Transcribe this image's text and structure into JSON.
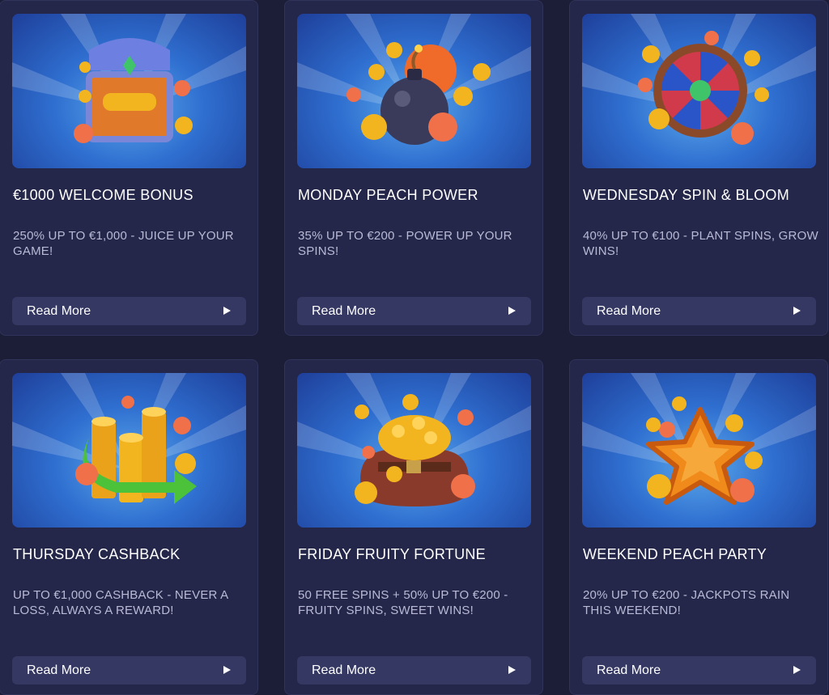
{
  "promotions": [
    {
      "title": "€1000 WELCOME BONUS",
      "description": "250% UP TO €1,000 - JUICE UP YOUR GAME!",
      "button_label": "Read More",
      "icon": "treasure-chest-icon"
    },
    {
      "title": "MONDAY PEACH POWER",
      "description": "35% UP TO €200 - POWER UP YOUR SPINS!",
      "button_label": "Read More",
      "icon": "bomb-icon"
    },
    {
      "title": "WEDNESDAY SPIN & BLOOM",
      "description": "40% UP TO €100 - PLANT SPINS, GROW WINS!",
      "button_label": "Read More",
      "icon": "prize-wheel-icon"
    },
    {
      "title": "THURSDAY CASHBACK",
      "description": "UP TO €1,000 CASHBACK - NEVER A LOSS, ALWAYS A REWARD!",
      "button_label": "Read More",
      "icon": "coin-stacks-arrow-icon"
    },
    {
      "title": "FRIDAY FRUITY FORTUNE",
      "description": "50 FREE SPINS + 50% UP TO €200 - FRUITY SPINS, SWEET WINS!",
      "button_label": "Read More",
      "icon": "coin-sack-icon"
    },
    {
      "title": "WEEKEND PEACH PARTY",
      "description": "20% UP TO €200 - JACKPOTS RAIN THIS WEEKEND!",
      "button_label": "Read More",
      "icon": "star-icon"
    }
  ],
  "colors": {
    "page_background": "#1c1d36",
    "card_background": "#24264a",
    "button_background": "#353863",
    "description_text": "#b9bbd6",
    "coin": "#f2b51f",
    "peach": "#f0704a"
  }
}
